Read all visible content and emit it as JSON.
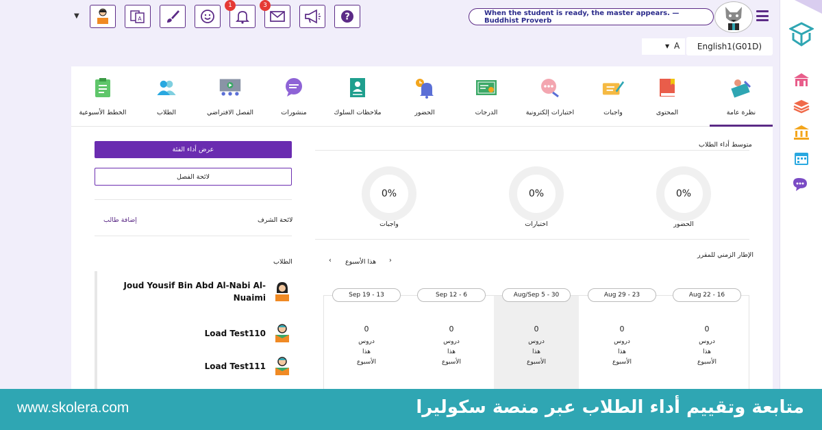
{
  "topbar": {
    "notifications_badge": "1",
    "messages_badge": "3",
    "quote": "When the student is ready, the master appears. —Buddhist Proverb"
  },
  "selectors": {
    "grade": "A",
    "course": "English1(G01D)"
  },
  "tabs": [
    {
      "label": "نظرة عامة",
      "icon": "overview-icon",
      "active": true
    },
    {
      "label": "المحتوى",
      "icon": "book-icon"
    },
    {
      "label": "واجبات",
      "icon": "assignment-icon"
    },
    {
      "label": "اختبارات إلكترونية",
      "icon": "quiz-icon"
    },
    {
      "label": "الدرجات",
      "icon": "certificate-icon"
    },
    {
      "label": "الحضور",
      "icon": "bell-clock-icon"
    },
    {
      "label": "ملاحظات السلوك",
      "icon": "behavior-icon"
    },
    {
      "label": "منشورات",
      "icon": "chat-icon"
    },
    {
      "label": "الفصل الافتراضي",
      "icon": "virtual-class-icon"
    },
    {
      "label": "الطلاب",
      "icon": "students-icon"
    },
    {
      "label": "الخطط الأسبوعية",
      "icon": "clipboard-icon"
    }
  ],
  "performance": {
    "title": "متوسط أداء الطلاب",
    "gauges": [
      {
        "label": "الحضور",
        "value": "0%"
      },
      {
        "label": "اختبارات",
        "value": "0%"
      },
      {
        "label": "واجبات",
        "value": "0%"
      }
    ]
  },
  "timeline": {
    "title": "الإطار الزمني للمقرر",
    "week_label": "هذا الأسبوع",
    "weeks": [
      {
        "range": "Aug 22 - 16",
        "count": "0",
        "unit": "دروس",
        "line1": "هذا",
        "line2": "الأسبوع"
      },
      {
        "range": "Aug 29 - 23",
        "count": "0",
        "unit": "دروس",
        "line1": "هذا",
        "line2": "الأسبوع"
      },
      {
        "range": "Aug/Sep 5 - 30",
        "count": "0",
        "unit": "دروس",
        "line1": "هذا",
        "line2": "الأسبوع",
        "current": true
      },
      {
        "range": "Sep 12 - 6",
        "count": "0",
        "unit": "دروس",
        "line1": "هذا",
        "line2": "الأسبوع"
      },
      {
        "range": "Sep 19 - 13",
        "count": "0",
        "unit": "دروس",
        "line1": "هذا",
        "line2": "الأسبوع"
      }
    ]
  },
  "left": {
    "class_performance_button": "عرض أداء الفئة",
    "class_list_button": "لائحة الفصل",
    "honor_list_label": "لائحة الشرف",
    "add_student_link": "إضافة طالب",
    "students_label": "الطلاب",
    "students": [
      {
        "name_line1": "Joud Yousif Bin Abd Al-Nabi Al-",
        "name_line2": "Nuaimi",
        "gender": "female"
      },
      {
        "name_line1": "Load Test110",
        "name_line2": "",
        "gender": "male"
      },
      {
        "name_line1": "Load Test111",
        "name_line2": "",
        "gender": "male"
      }
    ]
  },
  "footer": {
    "site": "www.skolera.com",
    "title": "متابعة وتقييم أداء الطلاب عبر منصة سكوليرا"
  },
  "colors": {
    "brand": "#5b2a86",
    "primary_button": "#6a2cb0",
    "footer": "#2fa6b3",
    "badge": "#e53935"
  }
}
